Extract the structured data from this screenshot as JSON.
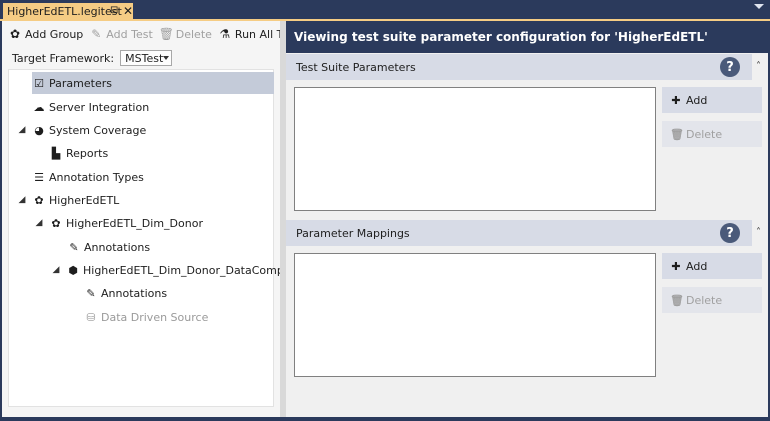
{
  "tab": {
    "title": "HigherEdETL.legitest",
    "pin_glyph": "⊟",
    "close_glyph": "✕"
  },
  "toolbar": {
    "add_group": "Add Group",
    "add_test": "Add Test",
    "delete": "Delete",
    "run_all": "Run All Tests"
  },
  "framework": {
    "label": "Target Framework:",
    "value": "MSTest"
  },
  "tree": {
    "parameters": "Parameters",
    "server_integration": "Server Integration",
    "system_coverage": "System Coverage",
    "reports": "Reports",
    "annotation_types": "Annotation Types",
    "higheredetl": "HigherEdETL",
    "dim_donor": "HigherEdETL_Dim_Donor",
    "annotations_1": "Annotations",
    "datacompare": "HigherEdETL_Dim_Donor_DataCompare",
    "annotations_2": "Annotations",
    "data_driven_source": "Data Driven Source"
  },
  "header": {
    "title": "Viewing test suite parameter configuration for 'HigherEdETL'"
  },
  "sections": {
    "suite_params": {
      "title": "Test Suite Parameters",
      "add": "Add",
      "delete": "Delete"
    },
    "mappings": {
      "title": "Parameter Mappings",
      "add": "Add",
      "delete": "Delete"
    }
  },
  "help_glyph": "?",
  "collapse_glyph": "˄",
  "colors": {
    "tab_active": "#f5cc84",
    "window_bg": "#2b3a5c",
    "selection": "#c4cbd9",
    "section_bg": "#d7dbe6"
  }
}
